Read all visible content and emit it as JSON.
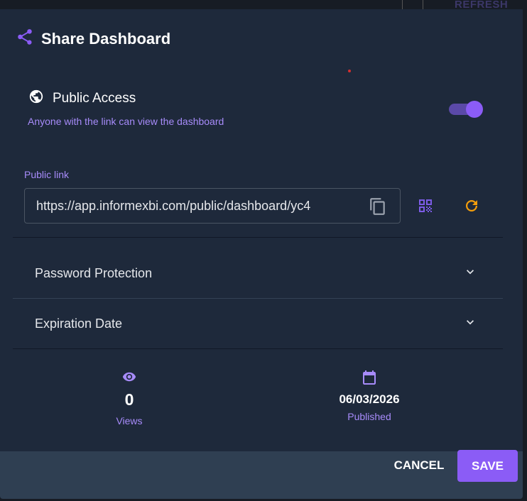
{
  "background": {
    "refresh_label": "REFRESH"
  },
  "dialog": {
    "title": "Share Dashboard",
    "public_access": {
      "title": "Public Access",
      "subtitle": "Anyone with the link can view the dashboard",
      "enabled": true
    },
    "public_link": {
      "label": "Public link",
      "value": "https://app.informexbi.com/public/dashboard/yc4"
    },
    "sections": [
      {
        "label": "Password Protection"
      },
      {
        "label": "Expiration Date"
      }
    ],
    "stats": {
      "views_value": "0",
      "views_label": "Views",
      "published_value": "06/03/2026",
      "published_label": "Published"
    },
    "buttons": {
      "cancel": "CANCEL",
      "save": "SAVE"
    }
  },
  "colors": {
    "accent": "#8b5cf6",
    "accent_text": "#a78bfa",
    "refresh_icon": "#f59e0b",
    "dialog_bg": "#1e293b",
    "footer_bg": "#2f3f52"
  }
}
